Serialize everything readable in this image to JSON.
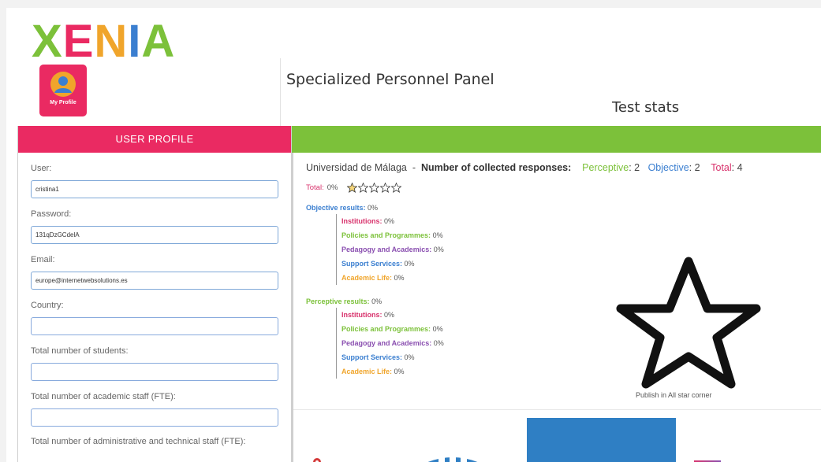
{
  "brand": {
    "logo_letters": [
      "X",
      "E",
      "N",
      "I",
      "A"
    ],
    "logo_colors": [
      "#7cc13a",
      "#ea2a62",
      "#f0a52b",
      "#3b7fd0",
      "#7cc13a"
    ],
    "profile_label": "My Profile"
  },
  "header": {
    "panel_title": "Specialized Personnel Panel",
    "section_title": "Test stats"
  },
  "user_profile": {
    "heading": "USER PROFILE",
    "fields": [
      {
        "label": "User:",
        "value": "cristina1"
      },
      {
        "label": "Password:",
        "value": "131qDzGCdelA"
      },
      {
        "label": "Email:",
        "value": "europe@internetwebsolutions.es"
      },
      {
        "label": "Country:",
        "value": ""
      },
      {
        "label": "Total number of students:",
        "value": ""
      },
      {
        "label": "Total number of academic staff (FTE):",
        "value": ""
      },
      {
        "label": "Total number of administrative and technical staff (FTE):",
        "value": ""
      }
    ]
  },
  "stats": {
    "university": "Universidad de Málaga",
    "separator": "-",
    "responses_label": "Number of collected responses:",
    "perceptive_label": "Perceptive",
    "perceptive_count": ": 2",
    "objective_label": "Objective",
    "objective_count": ": 2",
    "total_label": "Total",
    "total_count": ": 4",
    "overall_total_label": "Total:",
    "overall_total_value": "0%",
    "star_rating": 0,
    "objective": {
      "title": "Objective results:",
      "value": "0%",
      "items": [
        {
          "label": "Institutions:",
          "value": "0%"
        },
        {
          "label": "Policies and Programmes:",
          "value": "0%"
        },
        {
          "label": "Pedagogy and Academics:",
          "value": "0%"
        },
        {
          "label": "Support Services:",
          "value": "0%"
        },
        {
          "label": "Academic Life:",
          "value": "0%"
        }
      ]
    },
    "perceptive": {
      "title": "Perceptive results:",
      "value": "0%",
      "items": [
        {
          "label": "Institutions:",
          "value": "0%"
        },
        {
          "label": "Policies and Programmes:",
          "value": "0%"
        },
        {
          "label": "Pedagogy and Academics:",
          "value": "0%"
        },
        {
          "label": "Support Services:",
          "value": "0%"
        },
        {
          "label": "Academic Life:",
          "value": "0%"
        }
      ]
    },
    "publish_label": "Publish in All star corner"
  },
  "colors": {
    "pink": "#ea2a62",
    "green": "#7cc13a",
    "blue": "#3b7fd0",
    "purple": "#8a4fb0",
    "orange": "#f0a52b"
  }
}
